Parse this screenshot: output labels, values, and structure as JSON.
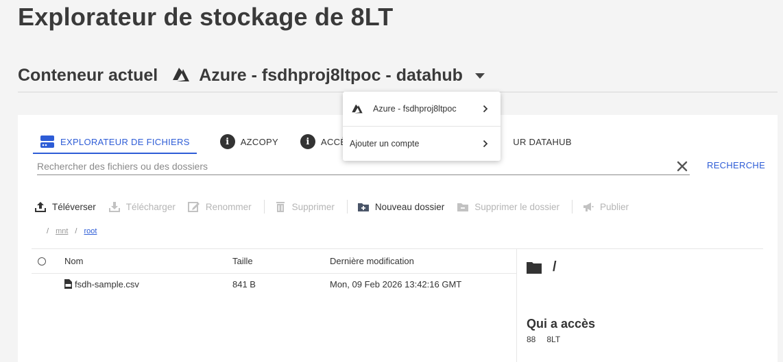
{
  "page": {
    "title": "Explorateur de stockage de 8LT"
  },
  "container": {
    "label": "Conteneur actuel",
    "name": "Azure - fsdhproj8ltpoc - datahub",
    "icon": "azure-icon"
  },
  "dropdown": {
    "items": [
      {
        "label": "Azure - fsdhproj8ltpoc",
        "icon": "azure-icon"
      },
      {
        "label": "Ajouter un compte"
      }
    ]
  },
  "tabs": [
    {
      "label": "EXPLORATEUR DE FICHIERS",
      "icon": "storage-icon",
      "active": true
    },
    {
      "label": "AZCOPY",
      "icon": "info-icon"
    },
    {
      "label": "ACCÈS",
      "icon": "info-icon"
    },
    {
      "label": "UR DATAHUB"
    }
  ],
  "search": {
    "placeholder": "Rechercher des fichiers ou des dossiers",
    "value": "",
    "button_label": "RECHERCHE"
  },
  "toolbar": {
    "upload": "Téléverser",
    "download": "Télécharger",
    "rename": "Renommer",
    "delete": "Supprimer",
    "new_folder": "Nouveau dossier",
    "delete_folder": "Supprimer le dossier",
    "publish": "Publier"
  },
  "breadcrumb": {
    "sep": "/",
    "items": [
      "mnt",
      "root"
    ]
  },
  "table": {
    "headers": {
      "name": "Nom",
      "size": "Taille",
      "modified": "Dernière modification"
    },
    "rows": [
      {
        "name": "fsdh-sample.csv",
        "size": "841 B",
        "modified": "Mon, 09 Feb 2026 13:42:16 GMT"
      }
    ]
  },
  "details": {
    "path": "/",
    "access_title": "Qui a accès",
    "access": {
      "count": "88",
      "name": "8LT"
    }
  },
  "colors": {
    "accent": "#2d5cd6",
    "disabled": "#b5b5b5",
    "text": "#333333",
    "background": "#f4f4f4"
  }
}
